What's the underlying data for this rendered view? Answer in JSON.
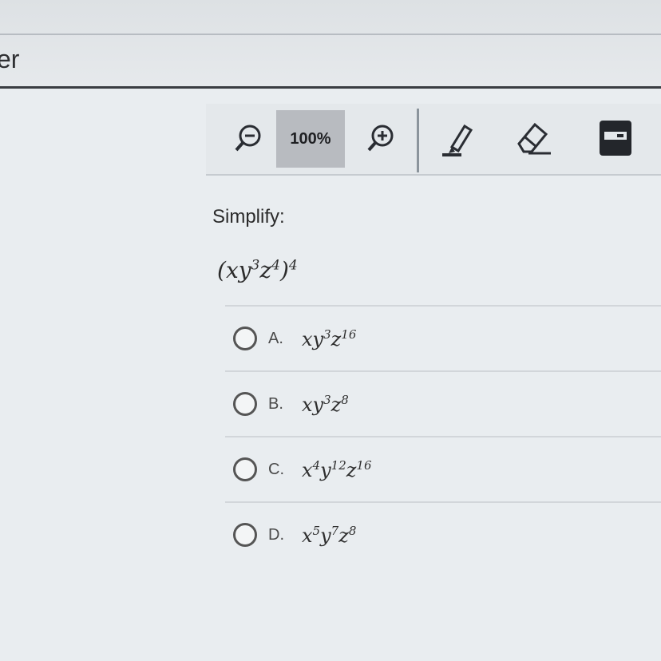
{
  "header": {
    "title_fragment": "er"
  },
  "toolbar": {
    "zoom_out_icon": "zoom-out-icon",
    "zoom_level": "100%",
    "zoom_in_icon": "zoom-in-icon",
    "highlighter_icon": "highlighter-icon",
    "eraser_icon": "eraser-icon",
    "calculator_icon": "calculator-icon"
  },
  "question": {
    "prompt": "Simplify:",
    "expression": {
      "base": "xy",
      "y_exp": "3",
      "z": "z",
      "z_exp": "4",
      "outer_exp": "4"
    }
  },
  "choices": [
    {
      "letter": "A.",
      "parts": [
        "xy",
        "3",
        "z",
        "16"
      ]
    },
    {
      "letter": "B.",
      "parts": [
        "xy",
        "3",
        "z",
        "8"
      ]
    },
    {
      "letter": "C.",
      "parts": [
        "x",
        "4",
        "y",
        "12",
        "z",
        "16"
      ]
    },
    {
      "letter": "D.",
      "parts": [
        "x",
        "5",
        "y",
        "7",
        "z",
        "8"
      ]
    }
  ]
}
